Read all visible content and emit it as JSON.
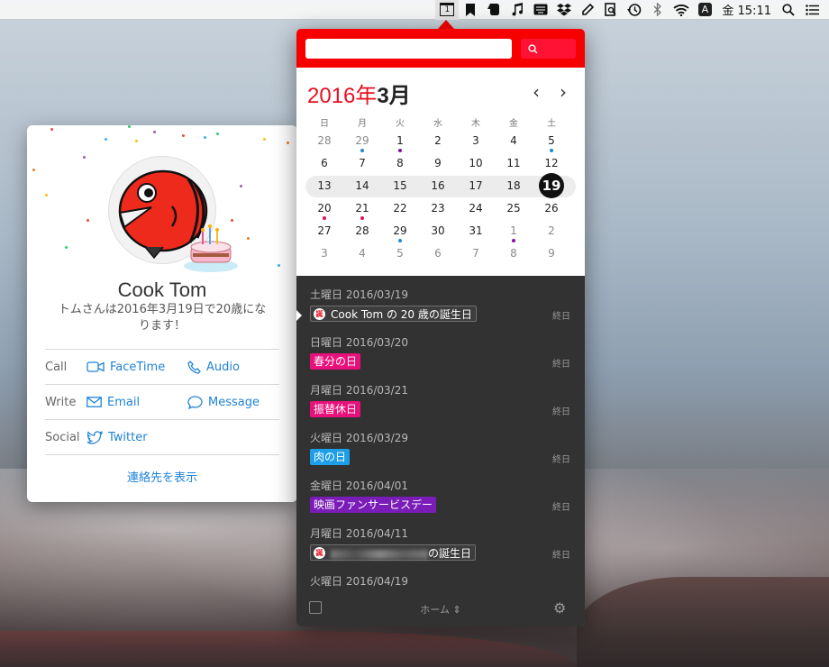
{
  "menubar": {
    "calendar_day": "1",
    "input_badge": "A",
    "clock": "金 15:11"
  },
  "card": {
    "name": "Cook Tom",
    "message": "トムさんは2016年3月19日で20歳になります！",
    "rows": [
      {
        "label": "Call",
        "actions": [
          {
            "label": "FaceTime",
            "icon": "video-icon"
          },
          {
            "label": "Audio",
            "icon": "phone-icon"
          }
        ]
      },
      {
        "label": "Write",
        "actions": [
          {
            "label": "Email",
            "icon": "envelope-icon"
          },
          {
            "label": "Message",
            "icon": "chat-bubble-icon"
          }
        ]
      },
      {
        "label": "Social",
        "actions": [
          {
            "label": "Twitter",
            "icon": "twitter-icon"
          }
        ]
      }
    ],
    "show_contact": "連絡先を表示"
  },
  "calendar": {
    "search_placeholder": "",
    "year_label": "2016年",
    "month_label": "3月",
    "prev": "‹",
    "next": "›",
    "weekdays": [
      "日",
      "月",
      "火",
      "水",
      "木",
      "金",
      "土"
    ],
    "weeks": [
      [
        {
          "d": "28",
          "o": true
        },
        {
          "d": "29",
          "o": true,
          "dot": "#1c8adb"
        },
        {
          "d": "1",
          "dot": "#8a0ca8"
        },
        {
          "d": "2"
        },
        {
          "d": "3"
        },
        {
          "d": "4"
        },
        {
          "d": "5",
          "dot": "#1c8adb"
        }
      ],
      [
        {
          "d": "6"
        },
        {
          "d": "7"
        },
        {
          "d": "8"
        },
        {
          "d": "9"
        },
        {
          "d": "10"
        },
        {
          "d": "11"
        },
        {
          "d": "12"
        }
      ],
      [
        {
          "d": "13"
        },
        {
          "d": "14"
        },
        {
          "d": "15"
        },
        {
          "d": "16"
        },
        {
          "d": "17"
        },
        {
          "d": "18"
        },
        {
          "d": "19",
          "today": true
        }
      ],
      [
        {
          "d": "20",
          "dot": "#e81050"
        },
        {
          "d": "21",
          "dot": "#e81050"
        },
        {
          "d": "22"
        },
        {
          "d": "23"
        },
        {
          "d": "24"
        },
        {
          "d": "25"
        },
        {
          "d": "26"
        }
      ],
      [
        {
          "d": "27"
        },
        {
          "d": "28"
        },
        {
          "d": "29",
          "dot": "#1c8adb"
        },
        {
          "d": "30"
        },
        {
          "d": "31"
        },
        {
          "d": "1",
          "o": true,
          "dot": "#8a0ca8"
        },
        {
          "d": "2",
          "o": true
        }
      ],
      [
        {
          "d": "3",
          "o": true
        },
        {
          "d": "4",
          "o": true
        },
        {
          "d": "5",
          "o": true
        },
        {
          "d": "6",
          "o": true
        },
        {
          "d": "7",
          "o": true
        },
        {
          "d": "8",
          "o": true
        },
        {
          "d": "9",
          "o": true
        }
      ]
    ]
  },
  "events": [
    {
      "date": "土曜日 2016/03/19",
      "title": "Cook Tom の 20 歳の誕生日",
      "kind": "bday",
      "allday": "終日"
    },
    {
      "date": "日曜日 2016/03/20",
      "title": "春分の日",
      "color": "#e8107a",
      "allday": "終日"
    },
    {
      "date": "月曜日 2016/03/21",
      "title": "振替休日",
      "color": "#e8107a",
      "allday": "終日"
    },
    {
      "date": "火曜日 2016/03/29",
      "title": "肉の日",
      "color": "#1c9ee8",
      "allday": "終日"
    },
    {
      "date": "金曜日 2016/04/01",
      "title": "映画ファンサービスデー",
      "color": "#7a1cb8",
      "allday": "終日"
    },
    {
      "date": "月曜日 2016/04/11",
      "title": "の誕生日",
      "kind": "bday-blur",
      "allday": "終日"
    },
    {
      "date": "火曜日 2016/04/19"
    }
  ],
  "footer": {
    "home": "ホーム ⇕",
    "gear": "⚙"
  },
  "bday_icon_text": "誕"
}
